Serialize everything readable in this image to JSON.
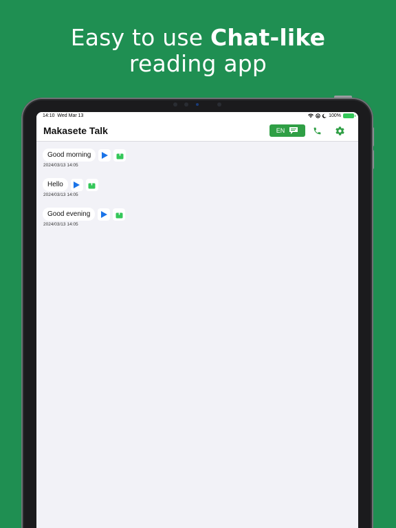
{
  "promo": {
    "line1_prefix": "Easy to use ",
    "line1_bold": "Chat-like",
    "line2": "reading app"
  },
  "status_bar": {
    "time": "14:10",
    "date": "Wed Mar 13",
    "battery": "100%"
  },
  "navbar": {
    "title": "Makasete Talk",
    "language_label": "EN",
    "icons": [
      "chat-bubble-icon",
      "phone-icon",
      "gear-icon"
    ]
  },
  "messages": [
    {
      "text": "Good morning",
      "timestamp": "2024/03/13 14:05"
    },
    {
      "text": "Hello",
      "timestamp": "2024/03/13 14:05"
    },
    {
      "text": "Good evening",
      "timestamp": "2024/03/13 14:05"
    }
  ],
  "colors": {
    "background": "#1f8f52",
    "accent": "#2f9f45",
    "play": "#1a73e8",
    "share": "#34c759"
  }
}
